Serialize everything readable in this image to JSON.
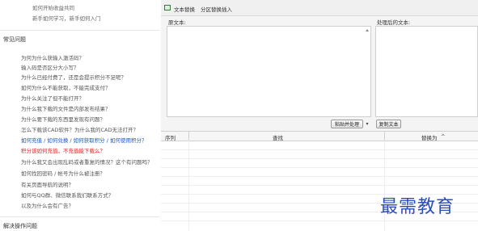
{
  "left": {
    "top_links": [
      "如何开始收益共同",
      "新手如何学习，新手如何入门"
    ],
    "faq_title": "常见问题",
    "faq_items": [
      {
        "text": "为何为什么获输入激活码？",
        "tone": "normal"
      },
      {
        "text": "输入码是否区分大小写？",
        "tone": "normal"
      },
      {
        "text": "为什么已经付费了，还是会提示积分不足呢？",
        "tone": "normal"
      },
      {
        "text": "如何为什么不能获取，不能完成支付？",
        "tone": "normal"
      },
      {
        "text": "为什么关注了但不能打开？",
        "tone": "normal"
      },
      {
        "text": "为什么我下载的文件是内部发布结果？",
        "tone": "normal"
      },
      {
        "text": "为什么要下载的东西里发现有问题？",
        "tone": "normal"
      },
      {
        "text": "怎么下载该CAD软件？为什么我的CAD无法打开？",
        "tone": "normal"
      },
      {
        "text": "如何充值 / 如何兑换 / 如何获取积分 / 如何使用积分？",
        "tone": "blue"
      },
      {
        "text": "积分该如何充值，不充值能下载么？",
        "tone": "red"
      },
      {
        "text": "为什么我又会出现乱码或者重复的情况？这个有问题吗？",
        "tone": "normal"
      },
      {
        "text": "如何找回密码 / 帐号为什么被注册？",
        "tone": "normal"
      },
      {
        "text": "有关页面导航的说明？",
        "tone": "normal"
      },
      {
        "text": "如何与QQ群、微信联系我们联系方式？",
        "tone": "normal"
      },
      {
        "text": "以及为什么会有广告？",
        "tone": "normal"
      }
    ],
    "section2_title": "解决操作问题"
  },
  "app": {
    "tabs": [
      "文本替换",
      "分区替换插入"
    ],
    "source_label": "原文本:",
    "result_label": "处理后的文本:",
    "buttons": {
      "paste": "粘贴并处理",
      "dropdown": "▾",
      "copy": "复制文本"
    },
    "table_headers": [
      "序列",
      "查找",
      "替换为"
    ],
    "table_sort_indicator": "^"
  },
  "watermark": "最需教育"
}
